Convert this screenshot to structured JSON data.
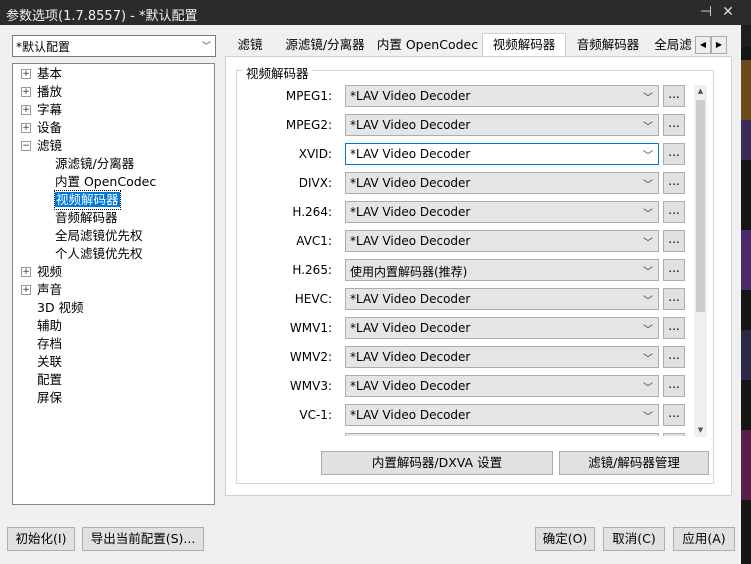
{
  "window": {
    "title": "参数选项(1.7.8557) - *默认配置",
    "pin_glyph": "⊣",
    "close_glyph": "✕"
  },
  "preset": {
    "value": "*默认配置"
  },
  "tree": [
    {
      "label": "基本",
      "expander": "+"
    },
    {
      "label": "播放",
      "expander": "+"
    },
    {
      "label": "字幕",
      "expander": "+"
    },
    {
      "label": "设备",
      "expander": "+"
    },
    {
      "label": "滤镜",
      "expander": "−"
    },
    {
      "label": "源滤镜/分离器",
      "expander": ""
    },
    {
      "label": "内置 OpenCodec",
      "expander": ""
    },
    {
      "label": "视频解码器",
      "expander": "",
      "selected": true
    },
    {
      "label": "音频解码器",
      "expander": ""
    },
    {
      "label": "全局滤镜优先权",
      "expander": ""
    },
    {
      "label": "个人滤镜优先权",
      "expander": ""
    },
    {
      "label": "视频",
      "expander": "+"
    },
    {
      "label": "声音",
      "expander": "+"
    },
    {
      "label": "3D 视频",
      "expander": ""
    },
    {
      "label": "辅助",
      "expander": ""
    },
    {
      "label": "存档",
      "expander": ""
    },
    {
      "label": "关联",
      "expander": ""
    },
    {
      "label": "配置",
      "expander": ""
    },
    {
      "label": "屏保",
      "expander": ""
    }
  ],
  "tabs": [
    "滤镜",
    "源滤镜/分离器",
    "内置 OpenCodec",
    "视频解码器",
    "音频解码器",
    "全局滤"
  ],
  "active_tab": "视频解码器",
  "group_title": "视频解码器",
  "decoders": [
    {
      "label": "MPEG1:",
      "value": "*LAV Video Decoder"
    },
    {
      "label": "MPEG2:",
      "value": "*LAV Video Decoder"
    },
    {
      "label": "XVID:",
      "value": "*LAV Video Decoder",
      "focused": true
    },
    {
      "label": "DIVX:",
      "value": "*LAV Video Decoder"
    },
    {
      "label": "H.264:",
      "value": "*LAV Video Decoder"
    },
    {
      "label": "AVC1:",
      "value": "*LAV Video Decoder"
    },
    {
      "label": "H.265:",
      "value": "使用内置解码器(推荐)"
    },
    {
      "label": "HEVC:",
      "value": "*LAV Video Decoder"
    },
    {
      "label": "WMV1:",
      "value": "*LAV Video Decoder"
    },
    {
      "label": "WMV2:",
      "value": "*LAV Video Decoder"
    },
    {
      "label": "WMV3:",
      "value": "*LAV Video Decoder"
    },
    {
      "label": "VC-1:",
      "value": "*LAV Video Decoder"
    },
    {
      "label": "",
      "value": ""
    }
  ],
  "more_button_label": "...",
  "panel_buttons": {
    "dxva": "内置解码器/DXVA 设置",
    "manage": "滤镜/解码器管理"
  },
  "footer": {
    "init": "初始化(I)",
    "export": "导出当前配置(S)...",
    "ok": "确定(O)",
    "cancel": "取消(C)",
    "apply": "应用(A)"
  }
}
